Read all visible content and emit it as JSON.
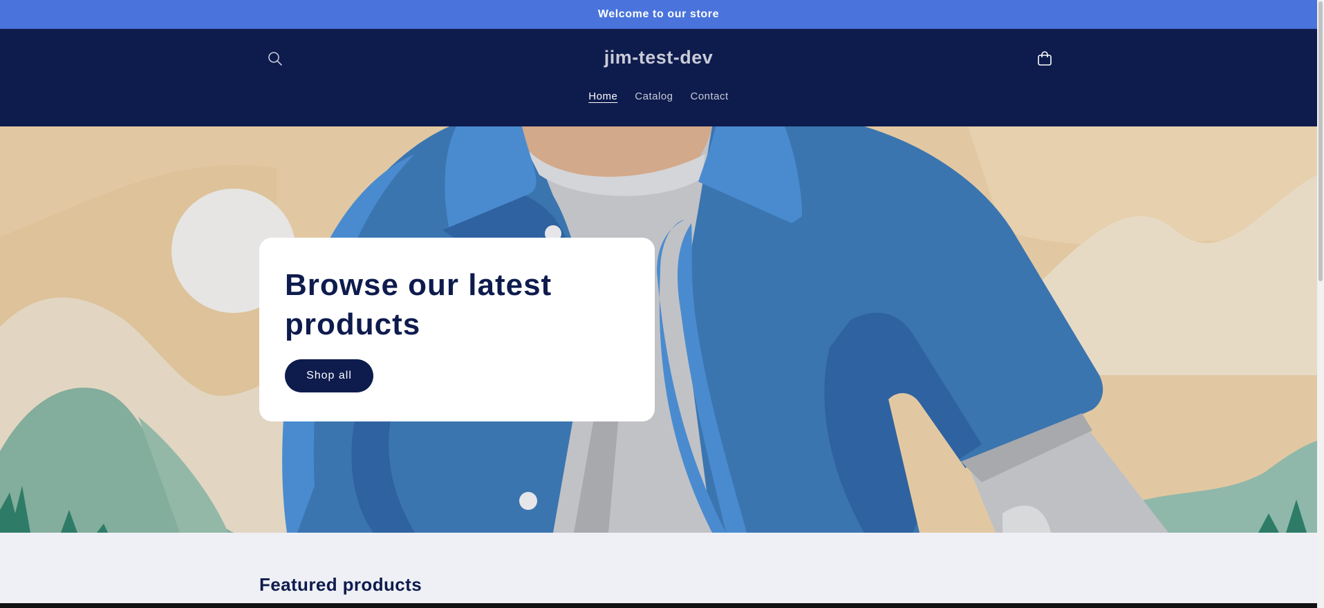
{
  "announcement": {
    "text": "Welcome to our store"
  },
  "header": {
    "store_name": "jim-test-dev",
    "search_icon": "search-icon",
    "cart_icon": "cart-icon",
    "nav": [
      {
        "label": "Home",
        "active": true
      },
      {
        "label": "Catalog",
        "active": false
      },
      {
        "label": "Contact",
        "active": false
      }
    ]
  },
  "hero": {
    "heading": "Browse our latest products",
    "button_label": "Shop all"
  },
  "featured": {
    "title": "Featured products"
  },
  "colors": {
    "announcement_bg": "#4a74dc",
    "header_bg": "#0e1b4d",
    "page_bg": "#eff0f5",
    "accent": "#0e1b4d"
  }
}
